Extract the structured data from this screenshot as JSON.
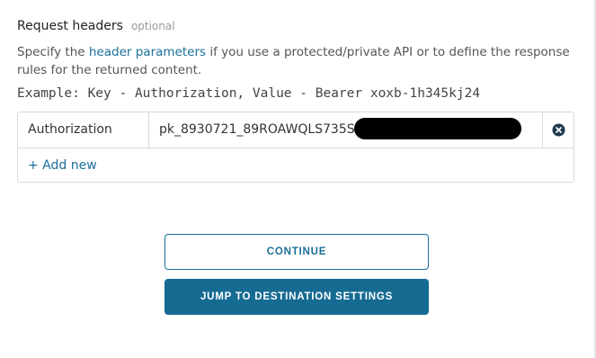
{
  "section": {
    "title": "Request headers",
    "optional_label": "optional",
    "description_pre": "Specify the ",
    "description_link": "header parameters",
    "description_post": " if you use a protected/private API or to define the response rules for the returned content.",
    "example": "Example: Key - Authorization, Value - Bearer xoxb-1h345kj24"
  },
  "headers": {
    "rows": [
      {
        "key": "Authorization",
        "value": "pk_8930721_89ROAWQLS735SI"
      }
    ],
    "add_new_label": "+ Add new",
    "remove_icon": "close-circle-icon"
  },
  "actions": {
    "continue_label": "CONTINUE",
    "jump_label": "JUMP TO DESTINATION SETTINGS"
  },
  "colors": {
    "accent": "#1a6f9a",
    "primary_button": "#166b92",
    "remove_icon": "#1f3a4d"
  }
}
